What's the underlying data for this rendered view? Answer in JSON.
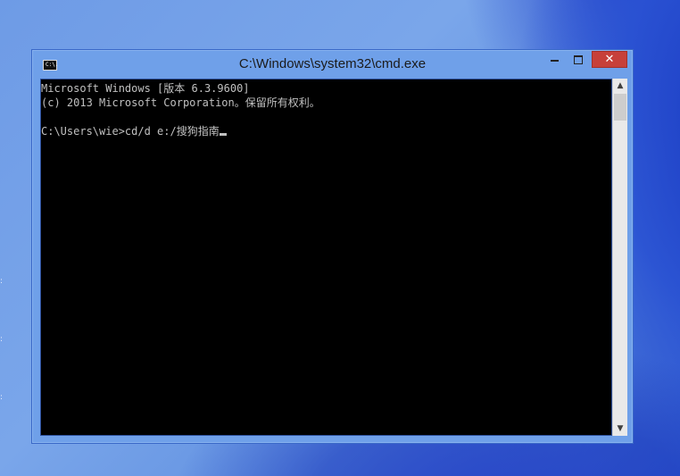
{
  "window": {
    "title": "C:\\Windows\\system32\\cmd.exe",
    "icon_text": "C:\\.",
    "icon": "console-window-icon"
  },
  "controls": {
    "minimize_icon": "minimize-icon",
    "maximize_icon": "maximize-icon",
    "close_label": "✕",
    "close_color": "#c7403a"
  },
  "console": {
    "lines": [
      "Microsoft Windows [版本 6.3.9600]",
      "(c) 2013 Microsoft Corporation。保留所有权利。",
      "",
      "C:\\Users\\wie>cd/d e:/搜狗指南"
    ],
    "background": "#000000",
    "text_color": "#c0c0c0"
  },
  "scrollbar": {
    "up_arrow": "▲",
    "down_arrow": "▼"
  }
}
